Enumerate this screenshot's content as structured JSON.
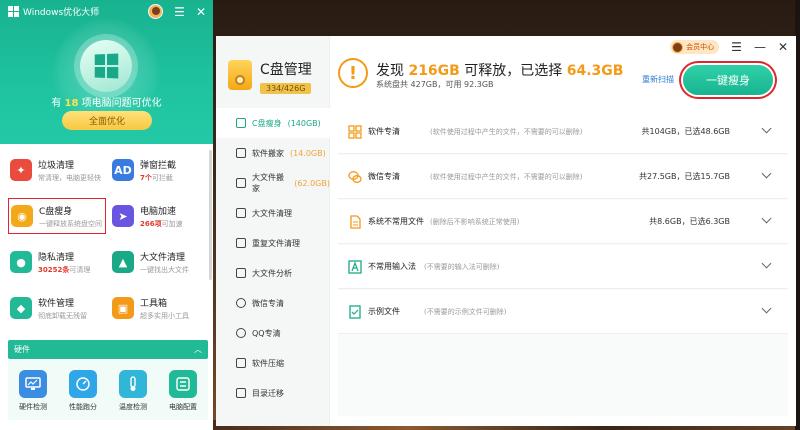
{
  "left_panel": {
    "app_title": "Windows优化大师",
    "status_prefix": "有 ",
    "problem_count": "18",
    "status_suffix": " 项电脑问题可优化",
    "optimize_button": "全面优化",
    "tools": [
      {
        "name": "垃圾清理",
        "desc": "常清理，电脑更轻快",
        "icon": "broom-icon",
        "color": "#e94b3c"
      },
      {
        "name": "弹窗拦截",
        "desc_hl": "7个",
        "desc": "可拦截",
        "icon": "popup-block-icon",
        "color": "#3a7be0"
      },
      {
        "name": "C盘瘦身",
        "desc": "一键释放系统盘空间",
        "icon": "drive-icon",
        "color": "#f3a817"
      },
      {
        "name": "电脑加速",
        "desc_hl": "266项",
        "desc": "可加速",
        "icon": "rocket-icon",
        "color": "#6a55e0"
      },
      {
        "name": "隐私清理",
        "desc_hl": "30252条",
        "desc": "可清理",
        "icon": "privacy-icon",
        "color": "#21b996"
      },
      {
        "name": "大文件清理",
        "desc": "一键找出大文件",
        "icon": "big-file-icon",
        "color": "#1aa987"
      },
      {
        "name": "软件管理",
        "desc": "彻底卸载无残留",
        "icon": "software-icon",
        "color": "#21b996"
      },
      {
        "name": "工具箱",
        "desc": "超多实用小工具",
        "icon": "toolbox-icon",
        "color": "#f39a18"
      }
    ],
    "hardware_label": "硬件",
    "hardware_items": [
      {
        "label": "硬件检测",
        "icon": "monitor-icon",
        "color": "#3a8de0"
      },
      {
        "label": "性能跑分",
        "icon": "gauge-icon",
        "color": "#2fa6e8"
      },
      {
        "label": "温度检测",
        "icon": "thermometer-icon",
        "color": "#2fb6d8"
      },
      {
        "label": "电脑配置",
        "icon": "config-icon",
        "color": "#21b996"
      }
    ]
  },
  "main_window": {
    "member_label": "会员中心",
    "header_title": "C盘管理",
    "disk_usage": "334/426G",
    "summary_pre": "发现 ",
    "summary_free": "216GB",
    "summary_mid": " 可释放，已选择 ",
    "summary_selected": "64.3GB",
    "sub_summary": "系统盘共 427GB，可用 92.3GB",
    "rescan": "重新扫描",
    "slim_button": "一键瘦身",
    "nav": [
      {
        "label": "C盘瘦身",
        "sub": "(140GB)",
        "icon": "broom-nav-icon",
        "active": true
      },
      {
        "label": "软件搬家",
        "sub": "(14.0GB)",
        "icon": "move-software-icon"
      },
      {
        "label": "大文件搬家",
        "sub": "(62.0GB)",
        "icon": "move-file-icon"
      },
      {
        "label": "大文件清理",
        "sub": "",
        "icon": "big-file-clean-icon"
      },
      {
        "label": "重复文件清理",
        "sub": "",
        "icon": "duplicate-icon"
      },
      {
        "label": "大文件分析",
        "sub": "",
        "icon": "analysis-icon"
      },
      {
        "label": "微信专清",
        "sub": "",
        "icon": "wechat-icon"
      },
      {
        "label": "QQ专清",
        "sub": "",
        "icon": "qq-icon"
      },
      {
        "label": "软件压缩",
        "sub": "",
        "icon": "compress-icon"
      },
      {
        "label": "目录迁移",
        "sub": "",
        "icon": "migrate-icon"
      }
    ],
    "rows": [
      {
        "name": "软件专清",
        "desc": "(软件使用过程中产生的文件，不需要的可以删除)",
        "size": "共104GB，已选48.6GB",
        "icon": "grid-icon",
        "color": "#f39a18"
      },
      {
        "name": "微信专清",
        "desc": "(软件使用过程中产生的文件，不需要的可以删除)",
        "size": "共27.5GB，已选15.7GB",
        "icon": "wechat-row-icon",
        "color": "#f39a18"
      },
      {
        "name": "系统不常用文件",
        "desc": "(删除后不影响系统正常使用)",
        "size": "共8.6GB，已选6.3GB",
        "icon": "file-icon",
        "color": "#f39a18"
      },
      {
        "name": "不常用输入法",
        "desc": "(不需要的输入法可删除)",
        "size": "",
        "icon": "input-method-icon",
        "color": "#1aa987"
      },
      {
        "name": "示例文件",
        "desc": "(不需要的示例文件可删除)",
        "size": "",
        "icon": "sample-file-icon",
        "color": "#1aa987"
      }
    ]
  }
}
